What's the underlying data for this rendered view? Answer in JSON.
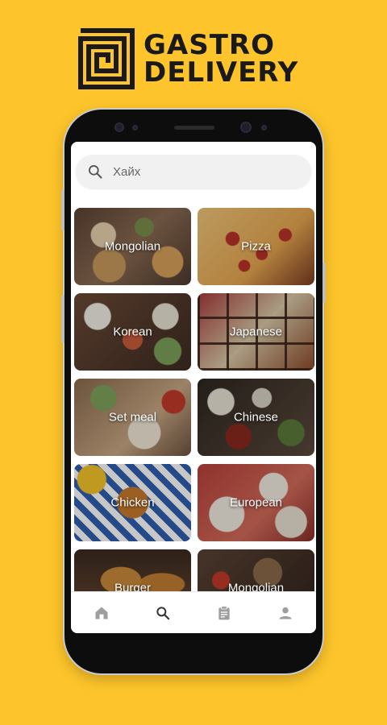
{
  "brand": {
    "line1": "GASTRO",
    "line2": "DELIVERY"
  },
  "search": {
    "placeholder": "Хайх"
  },
  "categories": [
    {
      "label": "Mongolian"
    },
    {
      "label": "Pizza"
    },
    {
      "label": "Korean"
    },
    {
      "label": "Japanese"
    },
    {
      "label": "Set meal"
    },
    {
      "label": "Chinese"
    },
    {
      "label": "Chicken"
    },
    {
      "label": "European"
    },
    {
      "label": "Burger"
    },
    {
      "label": "Mongolian"
    }
  ],
  "nav": {
    "items": [
      {
        "icon": "home-icon"
      },
      {
        "icon": "search-icon"
      },
      {
        "icon": "clipboard-icon"
      },
      {
        "icon": "profile-icon"
      }
    ],
    "active_index": 1
  },
  "colors": {
    "background": "#FDC52B",
    "phone": "#0d0d0d",
    "screen": "#ffffff"
  }
}
